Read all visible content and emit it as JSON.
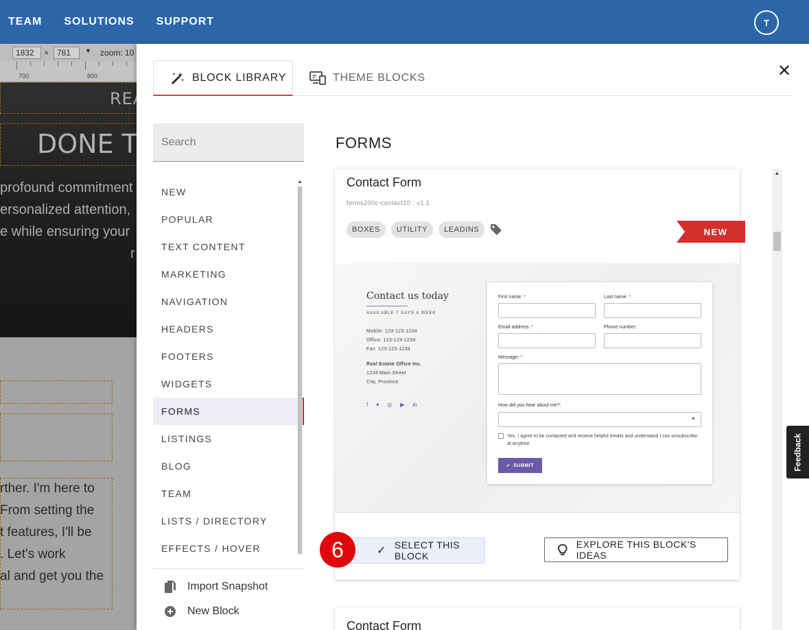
{
  "topnav": {
    "items": [
      "TEAM",
      "SOLUTIONS",
      "SUPPORT"
    ],
    "avatar_initial": "T"
  },
  "editor": {
    "width_value": "1832",
    "times": "×",
    "height_value": "781",
    "zoom_label": "zoom: 10",
    "ruler": [
      "700",
      "800"
    ],
    "hero_real": "REAL",
    "hero_done": "DONE THE",
    "hero_lines": [
      "profound commitment",
      "ersonalized attention,",
      "e while ensuring your",
      "r"
    ],
    "lower_lines": [
      "rther. I'm here to",
      "From setting the",
      "t features, I'll be",
      ". Let's work",
      "al and get you the"
    ]
  },
  "modal": {
    "tabs": {
      "block_library": "BLOCK LIBRARY",
      "theme_blocks": "THEME BLOCKS"
    },
    "close": "✕",
    "search_placeholder": "Search",
    "categories": [
      "NEW",
      "POPULAR",
      "TEXT CONTENT",
      "MARKETING",
      "NAVIGATION",
      "HEADERS",
      "FOOTERS",
      "WIDGETS",
      "FORMS",
      "LISTINGS",
      "BLOG",
      "TEAM",
      "LISTS / DIRECTORY",
      "EFFECTS / HOVER"
    ],
    "active_category": "FORMS",
    "actions": {
      "import_snapshot": "Import Snapshot",
      "new_block": "New Block"
    },
    "section_title": "FORMS",
    "card": {
      "title": "Contact Form",
      "id": "forms200c-contact10 : v1.1",
      "tags": [
        "BOXES",
        "UTILITY",
        "LEADINS"
      ],
      "badge": "NEW",
      "preview": {
        "heading": "Contact us today",
        "available": "AVAILABLE 7 DAYS A WEEK",
        "mobile": "Mobile: 123-123-1234",
        "office": "Office: 123-123-1234",
        "fax": "Fax: 123-123-1234",
        "company": "Real Estate Office Inc.",
        "street": "1234 Main Street",
        "city": "City, Province",
        "first_name": "First name:",
        "last_name": "Last name:",
        "email": "Email address:",
        "phone": "Phone number:",
        "message": "Message:",
        "hear": "How did you hear about me?:",
        "consent": "Yes, I agree to be contacted and receive helpful emails and understand I can unsubscribe at anytime.",
        "submit": "SUBMIT",
        "required_mark": "*"
      },
      "select_button": "SELECT THIS BLOCK",
      "explore_button": "EXPLORE THIS BLOCK'S IDEAS"
    },
    "step_number": "6",
    "card2_title": "Contact Form"
  },
  "feedback": "Feedback",
  "colors": {
    "topbar": "#2b66a8",
    "accent_red": "#e0060d",
    "badge_red": "#d32f2f",
    "submit_purple": "#6b5aa6"
  }
}
